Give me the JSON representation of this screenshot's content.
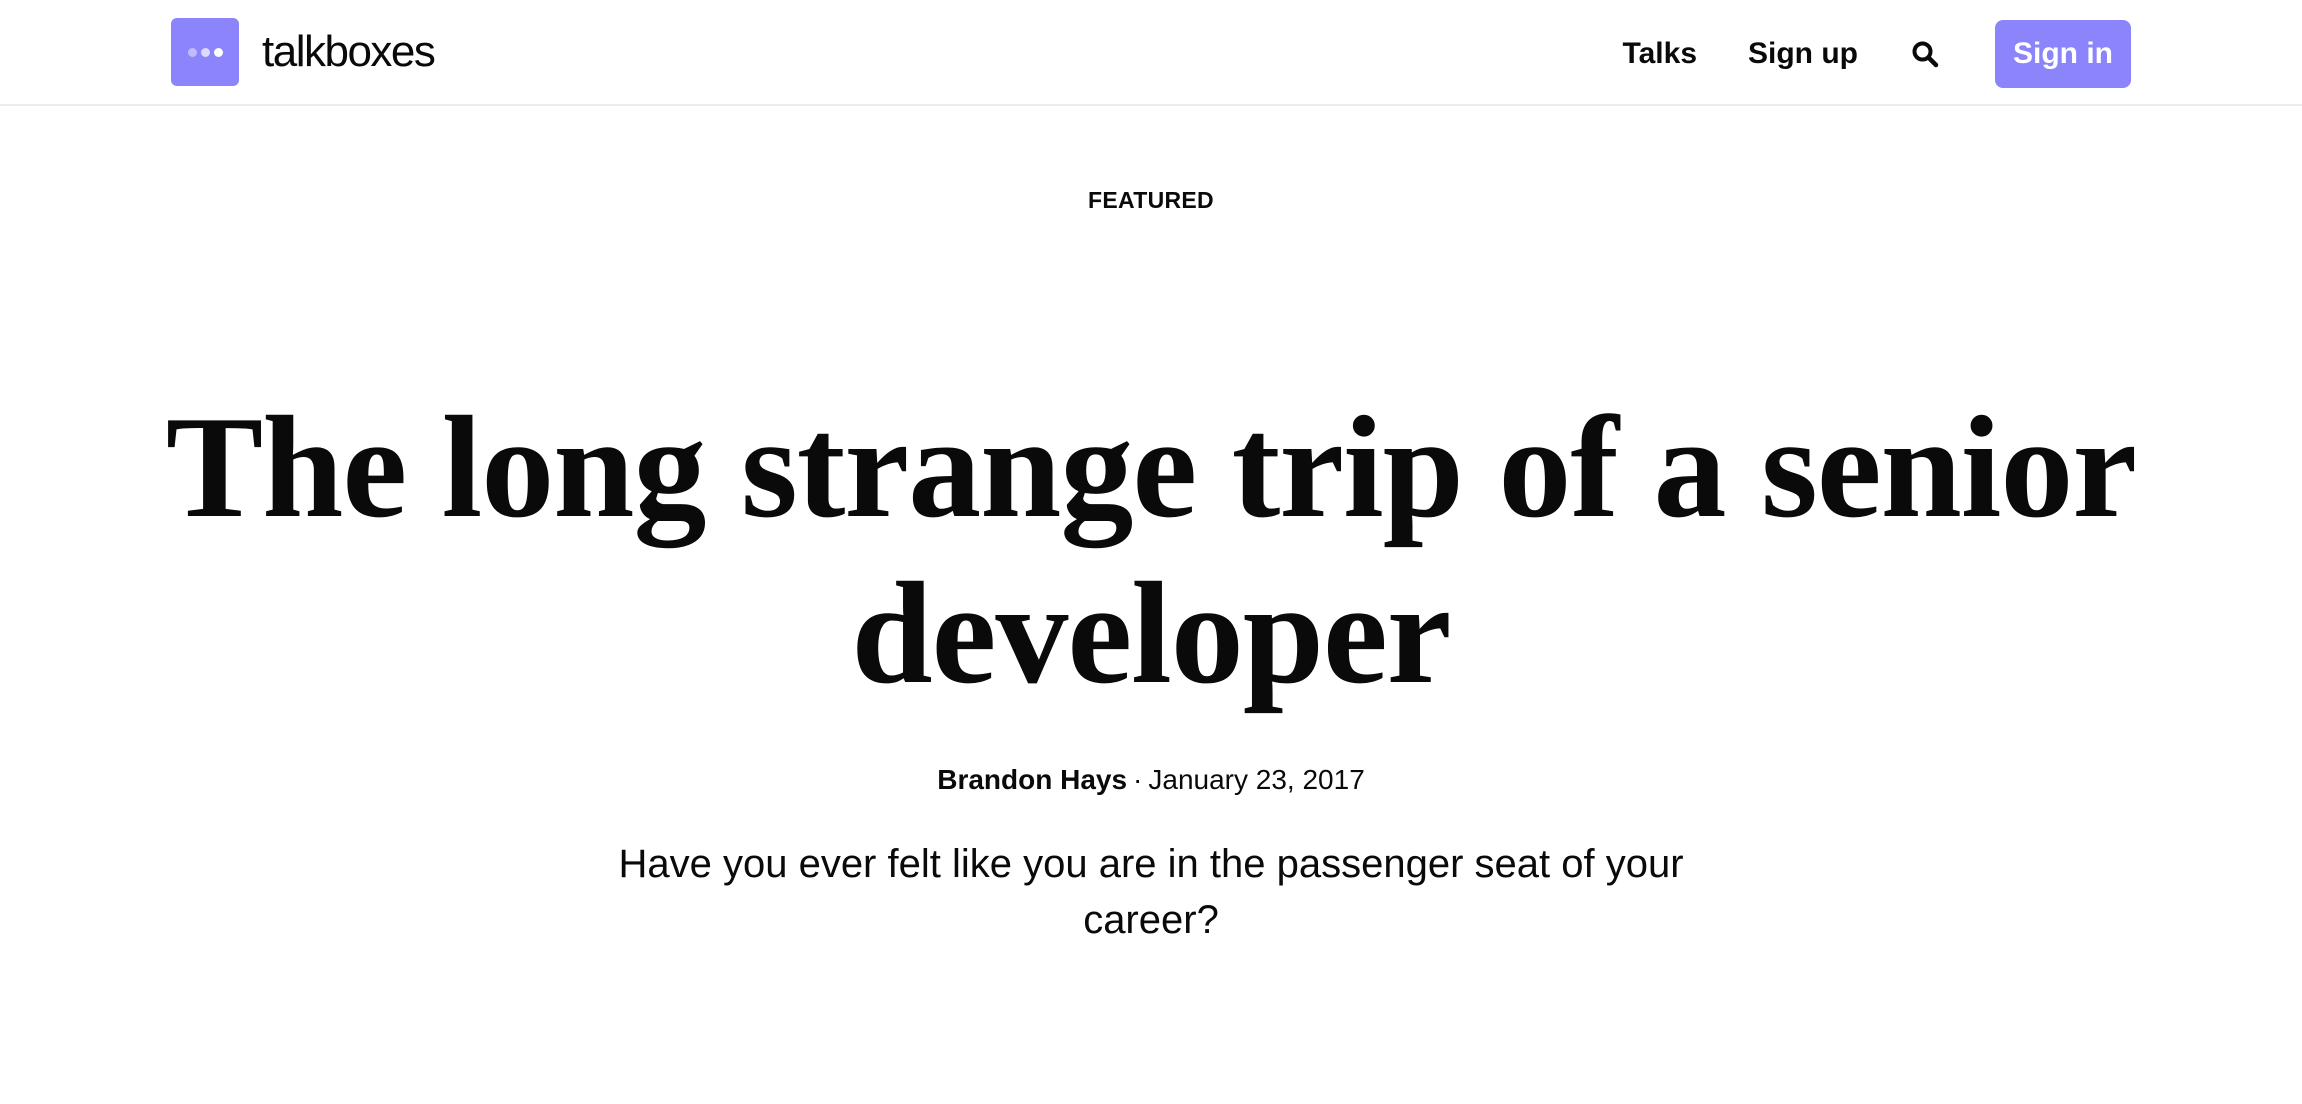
{
  "header": {
    "brand_name": "talkboxes",
    "nav": {
      "talks_label": "Talks",
      "signup_label": "Sign up",
      "signin_label": "Sign in"
    },
    "search_icon": "search-icon",
    "logo_icon": "speech-dots-icon"
  },
  "article": {
    "kicker": "FEATURED",
    "title": "The long strange trip of a senior developer",
    "author": "Brandon Hays",
    "separator": "·",
    "date": "January 23, 2017",
    "excerpt": "Have you ever felt like you are in the passenger seat of your career?"
  },
  "colors": {
    "accent": "#8c84fb",
    "text": "#0a0a0a",
    "background": "#ffffff",
    "divider": "#ececec"
  }
}
